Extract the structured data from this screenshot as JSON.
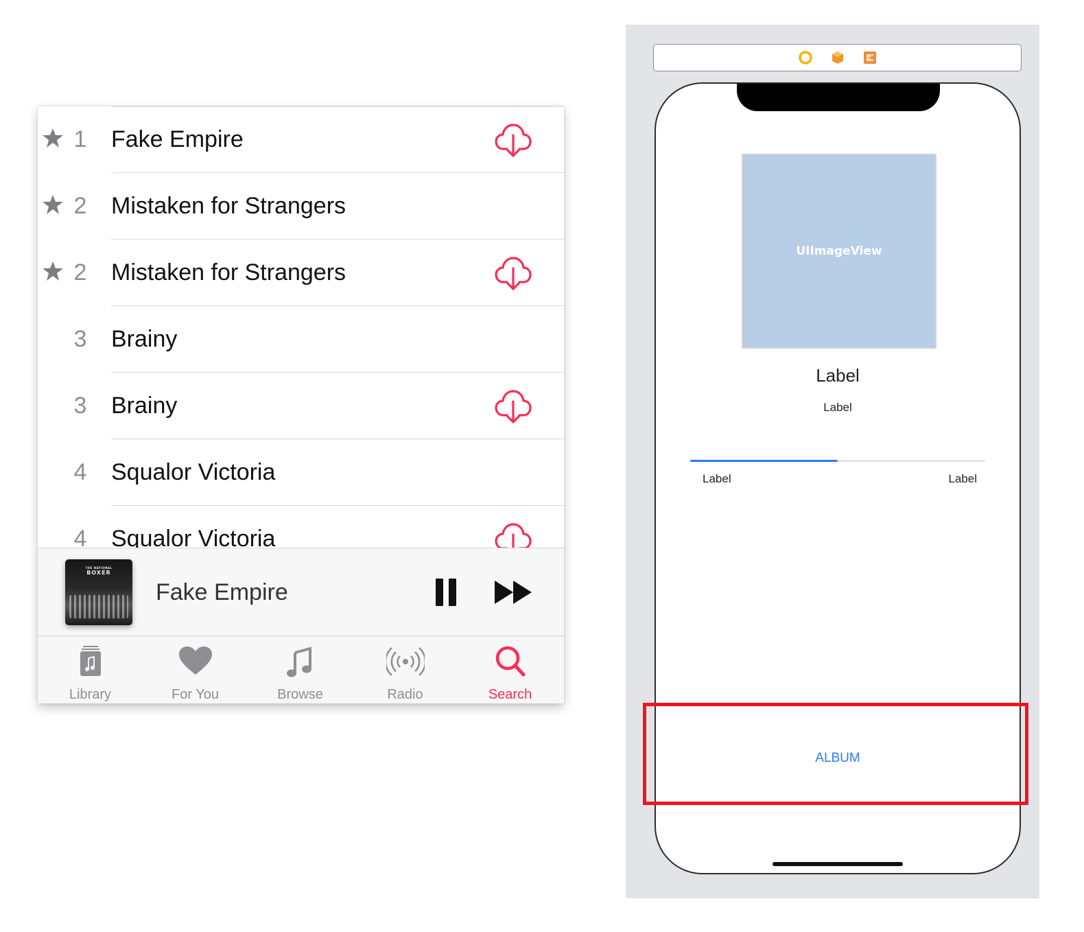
{
  "music_app": {
    "tracks": [
      {
        "starred": true,
        "number": "1",
        "title": "Fake Empire",
        "download": true
      },
      {
        "starred": true,
        "number": "2",
        "title": "Mistaken for Strangers",
        "download": false
      },
      {
        "starred": true,
        "number": "2",
        "title": "Mistaken for Strangers",
        "download": true
      },
      {
        "starred": false,
        "number": "3",
        "title": "Brainy",
        "download": false
      },
      {
        "starred": false,
        "number": "3",
        "title": "Brainy",
        "download": true
      },
      {
        "starred": false,
        "number": "4",
        "title": "Squalor Victoria",
        "download": false
      },
      {
        "starred": false,
        "number": "4",
        "title": "Squalor Victoria",
        "download": true
      }
    ],
    "now_playing": {
      "title": "Fake Empire",
      "album_art_text": "BOXER",
      "album_art_small_text": "THE NATIONAL"
    },
    "tabs": [
      {
        "label": "Library",
        "icon": "library-icon",
        "active": false
      },
      {
        "label": "For You",
        "icon": "heart-icon",
        "active": false
      },
      {
        "label": "Browse",
        "icon": "music-note-icon",
        "active": false
      },
      {
        "label": "Radio",
        "icon": "radio-icon",
        "active": false
      },
      {
        "label": "Search",
        "icon": "search-icon",
        "active": true
      }
    ],
    "colors": {
      "accent": "#fa2d55",
      "inactive": "#8e8e93"
    }
  },
  "storyboard": {
    "image_view_label": "UIImageView",
    "title_label": "Label",
    "subtitle_label": "Label",
    "progress": 0.5,
    "time_left_label": "Label",
    "time_right_label": "Label",
    "album_button": "ALBUM",
    "colors": {
      "tint": "#2c7cf0",
      "highlight": "#f0141f",
      "image_view": "#b8cde6"
    }
  }
}
